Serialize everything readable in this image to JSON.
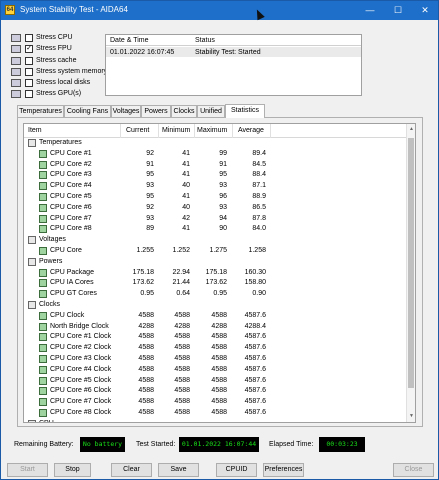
{
  "window": {
    "title": "System Stability Test - AIDA64",
    "title_icon": "64",
    "controls": [
      "—",
      "☐",
      "✕"
    ]
  },
  "stress_options": [
    {
      "label": "Stress CPU",
      "checked": false,
      "icon": "cpu-icon"
    },
    {
      "label": "Stress FPU",
      "checked": true,
      "icon": "fpu-icon"
    },
    {
      "label": "Stress cache",
      "checked": false,
      "icon": "cache-icon"
    },
    {
      "label": "Stress system memory",
      "checked": false,
      "icon": "memory-icon"
    },
    {
      "label": "Stress local disks",
      "checked": false,
      "icon": "disk-icon"
    },
    {
      "label": "Stress GPU(s)",
      "checked": false,
      "icon": "gpu-icon"
    }
  ],
  "log": {
    "headers": {
      "datetime": "Date & Time",
      "status": "Status"
    },
    "rows": [
      {
        "datetime": "01.01.2022 16:07:45",
        "status": "Stability Test: Started"
      }
    ]
  },
  "tabs": [
    "Temperatures",
    "Cooling Fans",
    "Voltages",
    "Powers",
    "Clocks",
    "Unified",
    "Statistics"
  ],
  "active_tab": "Statistics",
  "stats_table": {
    "headers": {
      "item": "Item",
      "current": "Current",
      "minimum": "Minimum",
      "maximum": "Maximum",
      "average": "Average"
    },
    "rows": [
      {
        "type": "group",
        "item": "Temperatures",
        "icon": "temperature-icon"
      },
      {
        "type": "item",
        "item": "CPU Core #1",
        "current": "92",
        "minimum": "41",
        "maximum": "99",
        "average": "89.4"
      },
      {
        "type": "item",
        "item": "CPU Core #2",
        "current": "91",
        "minimum": "41",
        "maximum": "91",
        "average": "84.5"
      },
      {
        "type": "item",
        "item": "CPU Core #3",
        "current": "95",
        "minimum": "41",
        "maximum": "95",
        "average": "88.4"
      },
      {
        "type": "item",
        "item": "CPU Core #4",
        "current": "93",
        "minimum": "40",
        "maximum": "93",
        "average": "87.1"
      },
      {
        "type": "item",
        "item": "CPU Core #5",
        "current": "95",
        "minimum": "41",
        "maximum": "96",
        "average": "88.9"
      },
      {
        "type": "item",
        "item": "CPU Core #6",
        "current": "92",
        "minimum": "40",
        "maximum": "93",
        "average": "86.5"
      },
      {
        "type": "item",
        "item": "CPU Core #7",
        "current": "93",
        "minimum": "42",
        "maximum": "94",
        "average": "87.8"
      },
      {
        "type": "item",
        "item": "CPU Core #8",
        "current": "89",
        "minimum": "41",
        "maximum": "90",
        "average": "84.0"
      },
      {
        "type": "group",
        "item": "Voltages",
        "icon": "voltage-icon"
      },
      {
        "type": "item",
        "item": "CPU Core",
        "current": "1.255",
        "minimum": "1.252",
        "maximum": "1.275",
        "average": "1.258"
      },
      {
        "type": "group",
        "item": "Powers",
        "icon": "power-icon"
      },
      {
        "type": "item",
        "item": "CPU Package",
        "current": "175.18",
        "minimum": "22.94",
        "maximum": "175.18",
        "average": "160.30"
      },
      {
        "type": "item",
        "item": "CPU IA Cores",
        "current": "173.62",
        "minimum": "21.44",
        "maximum": "173.62",
        "average": "158.80"
      },
      {
        "type": "item",
        "item": "CPU GT Cores",
        "current": "0.95",
        "minimum": "0.64",
        "maximum": "0.95",
        "average": "0.90"
      },
      {
        "type": "group",
        "item": "Clocks",
        "icon": "clock-icon"
      },
      {
        "type": "item",
        "item": "CPU Clock",
        "current": "4588",
        "minimum": "4588",
        "maximum": "4588",
        "average": "4587.6"
      },
      {
        "type": "item",
        "item": "North Bridge Clock",
        "current": "4288",
        "minimum": "4288",
        "maximum": "4288",
        "average": "4288.4"
      },
      {
        "type": "item",
        "item": "CPU Core #1 Clock",
        "current": "4588",
        "minimum": "4588",
        "maximum": "4588",
        "average": "4587.6"
      },
      {
        "type": "item",
        "item": "CPU Core #2 Clock",
        "current": "4588",
        "minimum": "4588",
        "maximum": "4588",
        "average": "4587.6"
      },
      {
        "type": "item",
        "item": "CPU Core #3 Clock",
        "current": "4588",
        "minimum": "4588",
        "maximum": "4588",
        "average": "4587.6"
      },
      {
        "type": "item",
        "item": "CPU Core #4 Clock",
        "current": "4588",
        "minimum": "4588",
        "maximum": "4588",
        "average": "4587.6"
      },
      {
        "type": "item",
        "item": "CPU Core #5 Clock",
        "current": "4588",
        "minimum": "4588",
        "maximum": "4588",
        "average": "4587.6"
      },
      {
        "type": "item",
        "item": "CPU Core #6 Clock",
        "current": "4588",
        "minimum": "4588",
        "maximum": "4588",
        "average": "4587.6"
      },
      {
        "type": "item",
        "item": "CPU Core #7 Clock",
        "current": "4588",
        "minimum": "4588",
        "maximum": "4588",
        "average": "4587.6"
      },
      {
        "type": "item",
        "item": "CPU Core #8 Clock",
        "current": "4588",
        "minimum": "4588",
        "maximum": "4588",
        "average": "4587.6"
      },
      {
        "type": "group",
        "item": "CPU",
        "icon": "cpu-icon"
      }
    ]
  },
  "status": {
    "battery_label": "Remaining Battery:",
    "battery_value": "No battery",
    "started_label": "Test Started:",
    "started_value": "01.01.2022 16:07:44",
    "elapsed_label": "Elapsed Time:",
    "elapsed_value": "00:03:23"
  },
  "buttons": [
    {
      "label": "Start",
      "name": "start-button",
      "enabled": false
    },
    {
      "label": "Stop",
      "name": "stop-button",
      "enabled": true
    },
    {
      "label": "Clear",
      "name": "clear-button",
      "enabled": true
    },
    {
      "label": "Save",
      "name": "save-button",
      "enabled": true
    },
    {
      "label": "CPUID",
      "name": "cpuid-button",
      "enabled": true
    },
    {
      "label": "Preferences",
      "name": "preferences-button",
      "enabled": true
    },
    {
      "label": "Close",
      "name": "close-button",
      "enabled": false
    }
  ],
  "colors": {
    "titlebar": "#1e6fc9",
    "lcd_text": "#19e019",
    "lcd_bg": "#000000"
  }
}
